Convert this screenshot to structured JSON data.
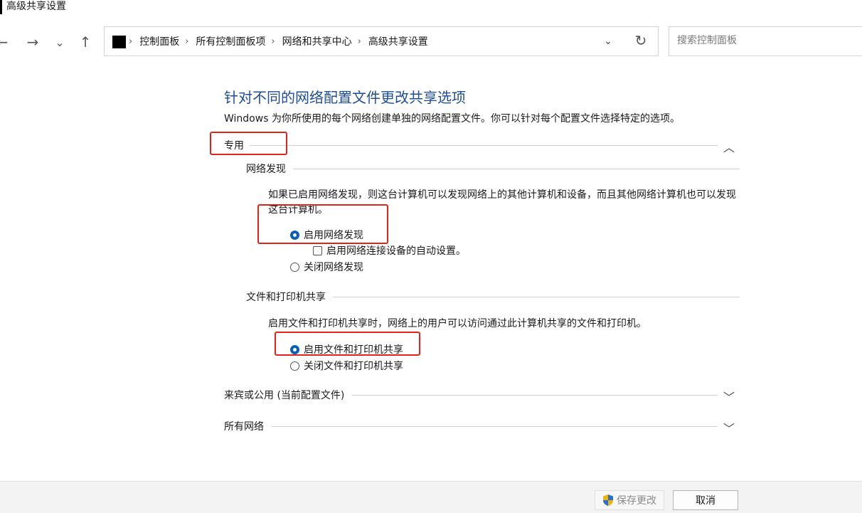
{
  "window": {
    "title": "高级共享设置"
  },
  "nav": {
    "back": "←",
    "forward": "→",
    "recent": "⌄",
    "up": "↑"
  },
  "address": {
    "crumbs": [
      "控制面板",
      "所有控制面板项",
      "网络和共享中心",
      "高级共享设置"
    ],
    "separator": "›",
    "dropdown": "⌄",
    "refresh": "↻"
  },
  "search": {
    "placeholder": "搜索控制面板"
  },
  "main": {
    "heading": "针对不同的网络配置文件更改共享选项",
    "description": "Windows 为你所使用的每个网络创建单独的网络配置文件。你可以针对每个配置文件选择特定的选项。",
    "private": {
      "label": "专用",
      "chevron": "︿",
      "network_discovery": {
        "label": "网络发现",
        "description": "如果已启用网络发现，则这台计算机可以发现网络上的其他计算机和设备，而且其他网络计算机也可以发现这台计算机。",
        "enable": "启用网络发现",
        "auto_setup": "启用网络连接设备的自动设置。",
        "disable": "关闭网络发现"
      },
      "file_sharing": {
        "label": "文件和打印机共享",
        "description": "启用文件和打印机共享时，网络上的用户可以访问通过此计算机共享的文件和打印机。",
        "enable": "启用文件和打印机共享",
        "disable": "关闭文件和打印机共享"
      }
    },
    "guest": {
      "label": "来宾或公用 (当前配置文件)",
      "chevron": "﹀"
    },
    "all": {
      "label": "所有网络",
      "chevron": "﹀"
    }
  },
  "footer": {
    "save": "保存更改",
    "cancel": "取消"
  },
  "colors": {
    "accent": "#0a5fb8",
    "heading": "#1f4e99",
    "highlight": "#e0231c"
  }
}
